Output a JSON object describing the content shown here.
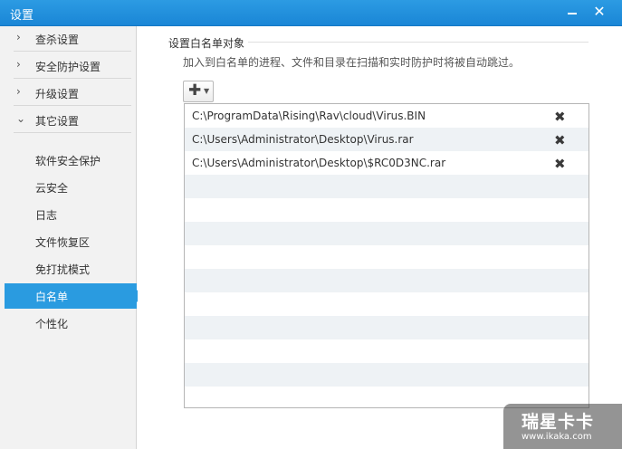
{
  "window": {
    "title": "设置"
  },
  "sidebar": {
    "categories": [
      {
        "label": "查杀设置",
        "arrow": "›"
      },
      {
        "label": "安全防护设置",
        "arrow": "›"
      },
      {
        "label": "升级设置",
        "arrow": "›"
      },
      {
        "label": "其它设置",
        "arrow": "⌄"
      }
    ],
    "items": [
      {
        "label": "软件安全保护"
      },
      {
        "label": "云安全"
      },
      {
        "label": "日志"
      },
      {
        "label": "文件恢复区"
      },
      {
        "label": "免打扰模式"
      },
      {
        "label": "白名单",
        "selected": true
      },
      {
        "label": "个性化"
      }
    ]
  },
  "main": {
    "section_title": "设置白名单对象",
    "description": "加入到白名单的进程、文件和目录在扫描和实时防护时将被自动跳过。",
    "add_button": {
      "icon": "plus-icon",
      "dropdown": "dropdown-arrow-icon"
    },
    "whitelist": [
      {
        "path": "C:\\ProgramData\\Rising\\Rav\\cloud\\Virus.BIN"
      },
      {
        "path": "C:\\Users\\Administrator\\Desktop\\Virus.rar"
      },
      {
        "path": "C:\\Users\\Administrator\\Desktop\\$RC0D3NC.rar"
      }
    ]
  },
  "watermark": {
    "brand": "瑞星卡卡",
    "url": "www.ikaka.com"
  },
  "colors": {
    "accent": "#2a9be0",
    "titlebar": "#1f8edb",
    "row_alt": "#eef2f5"
  }
}
